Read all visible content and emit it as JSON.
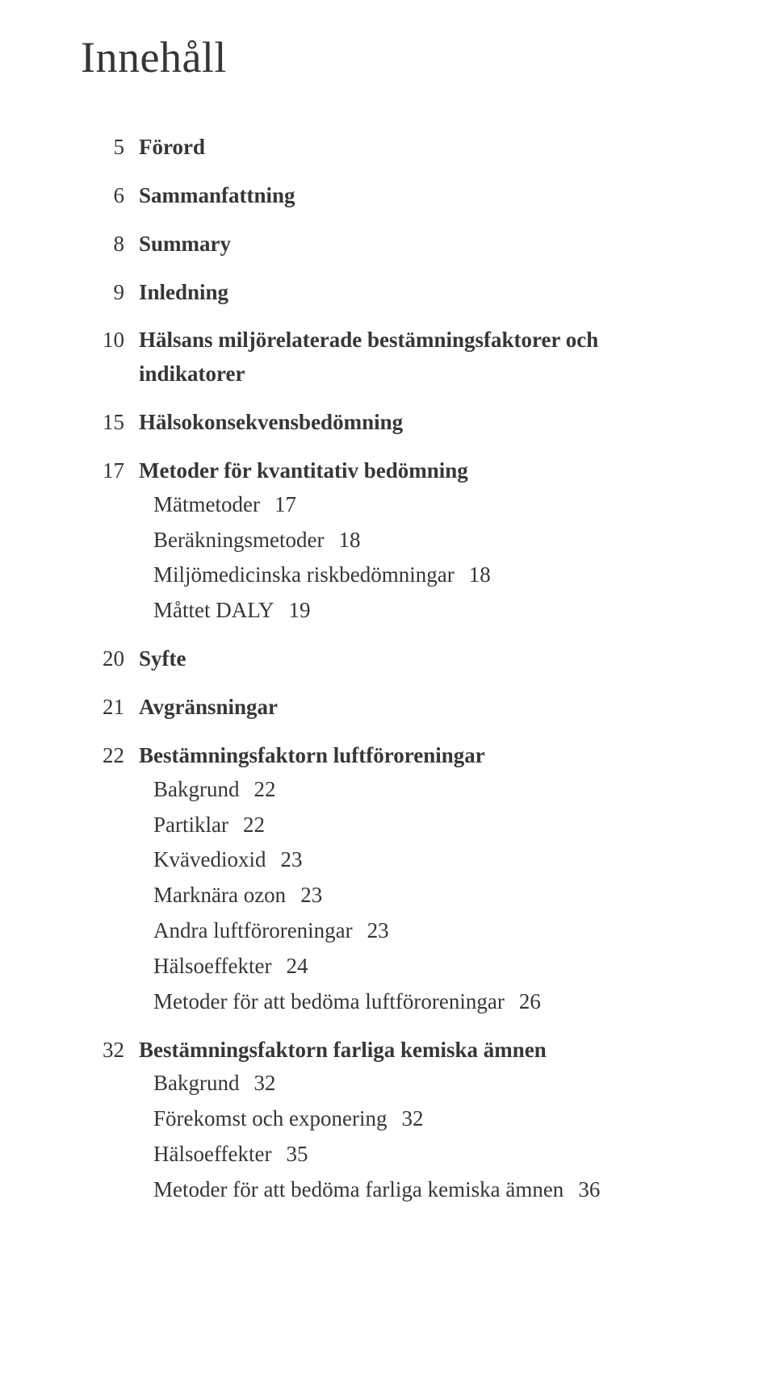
{
  "title": "Innehåll",
  "entries": [
    {
      "page": "5",
      "label": "Förord",
      "bold": true
    },
    {
      "page": "6",
      "label": "Sammanfattning",
      "bold": true
    },
    {
      "page": "8",
      "label": "Summary",
      "bold": true
    },
    {
      "page": "9",
      "label": "Inledning",
      "bold": true
    },
    {
      "page": "10",
      "label": "Hälsans miljörelaterade bestämningsfaktorer och indikatorer",
      "bold": true
    },
    {
      "page": "15",
      "label": "Hälsokonsekvensbedömning",
      "bold": true
    },
    {
      "page": "17",
      "label": "Metoder för kvantitativ bedömning",
      "bold": true,
      "subs": [
        {
          "label": "Mätmetoder",
          "page": "17"
        },
        {
          "label": "Beräkningsmetoder",
          "page": "18"
        },
        {
          "label": "Miljömedicinska riskbedömningar",
          "page": "18"
        },
        {
          "label": "Måttet DALY",
          "page": "19"
        }
      ]
    },
    {
      "page": "20",
      "label": "Syfte",
      "bold": true
    },
    {
      "page": "21",
      "label": "Avgränsningar",
      "bold": true
    },
    {
      "page": "22",
      "label": "Bestämningsfaktorn luftföroreningar",
      "bold": true,
      "subs": [
        {
          "label": "Bakgrund",
          "page": "22"
        },
        {
          "label": "Partiklar",
          "page": "22"
        },
        {
          "label": "Kvävedioxid",
          "page": "23"
        },
        {
          "label": "Marknära ozon",
          "page": "23"
        },
        {
          "label": "Andra luftföroreningar",
          "page": "23"
        },
        {
          "label": "Hälsoeffekter",
          "page": "24"
        },
        {
          "label": "Metoder för att bedöma luftföroreningar",
          "page": "26"
        }
      ]
    },
    {
      "page": "32",
      "label": "Bestämningsfaktorn farliga kemiska ämnen",
      "bold": true,
      "subs": [
        {
          "label": "Bakgrund",
          "page": "32"
        },
        {
          "label": "Förekomst och exponering",
          "page": "32"
        },
        {
          "label": "Hälsoeffekter",
          "page": "35"
        },
        {
          "label": "Metoder för att bedöma farliga kemiska ämnen",
          "page": "36"
        }
      ]
    }
  ]
}
